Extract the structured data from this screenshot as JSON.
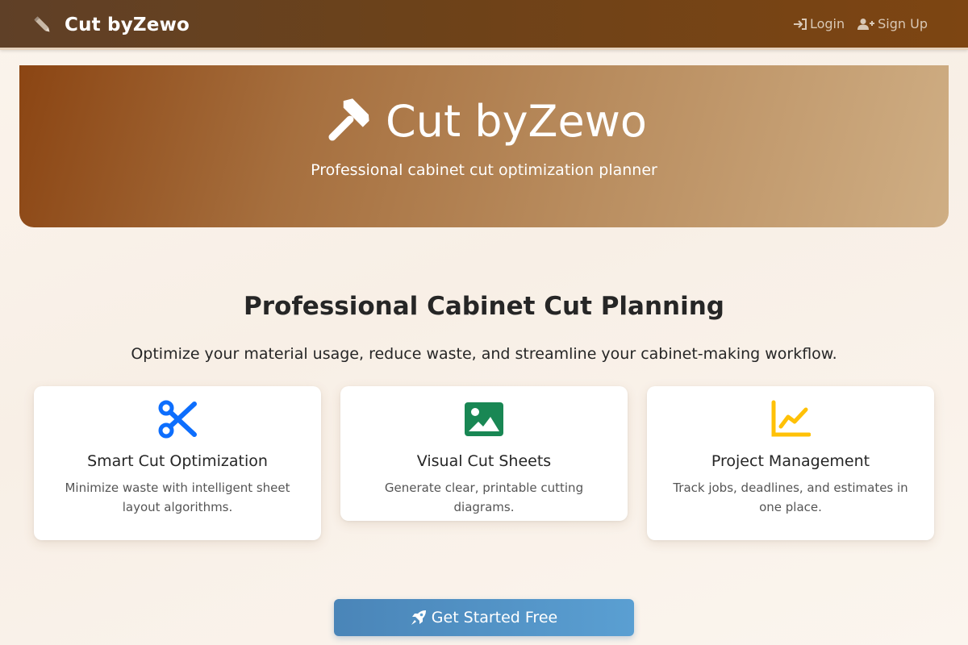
{
  "navbar": {
    "brand": "Cut byZewo",
    "brand_icon": "ruler-pencil-icon",
    "links": [
      {
        "label": "Login",
        "icon": "sign-in-icon"
      },
      {
        "label": "Sign Up",
        "icon": "user-plus-icon"
      }
    ]
  },
  "hero": {
    "title": "Cut byZewo",
    "icon": "hammer-icon",
    "subtitle": "Professional cabinet cut optimization planner"
  },
  "section": {
    "title": "Professional Cabinet Cut Planning",
    "lead": "Optimize your material usage, reduce waste, and streamline your cabinet-making workflow."
  },
  "features": [
    {
      "title": "Smart Cut Optimization",
      "text": "Minimize waste with intelligent sheet layout algorithms.",
      "icon": "scissors-icon",
      "color": "#0d6efd"
    },
    {
      "title": "Visual Cut Sheets",
      "text": "Generate clear, printable cutting diagrams.",
      "icon": "image-icon",
      "color": "#198754"
    },
    {
      "title": "Project Management",
      "text": "Track jobs, deadlines, and estimates in one place.",
      "icon": "chart-line-icon",
      "color": "#ffc107"
    }
  ],
  "cta": {
    "label": "Get Started Free",
    "icon": "rocket-icon"
  },
  "colors": {
    "navbar": "#6d4219",
    "hero_start": "#8b4513",
    "hero_end": "#cfae84",
    "cta": "#5a9fd2"
  }
}
